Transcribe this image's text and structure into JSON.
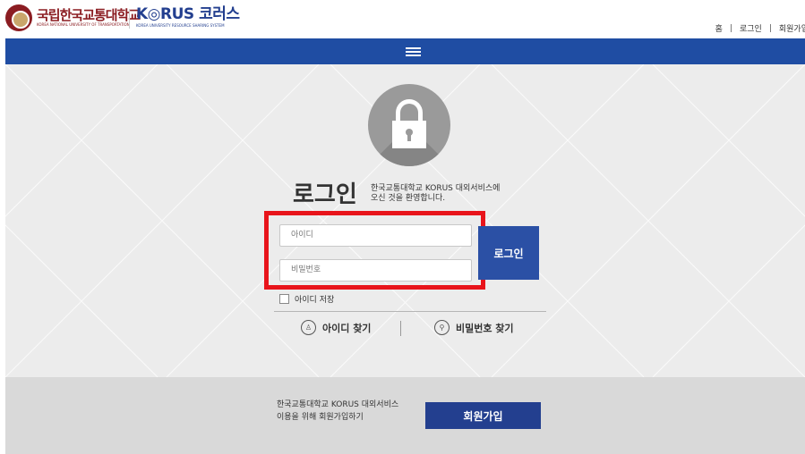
{
  "header": {
    "univ_name": "국립한국교통대학교",
    "univ_sub": "KOREA NATIONAL UNIVERSITY OF TRANSPORTATION",
    "korus_name": "K◎RUS 코러스",
    "korus_sub": "KOREA UNIVERSITY RESOURCE SHARING SYSTEM",
    "nav": {
      "home": "홈",
      "login": "로그인",
      "signup": "회원가입",
      "separator": "|"
    }
  },
  "login": {
    "title": "로그인",
    "welcome_line1": "한국교통대학교 KORUS 대외서비스에",
    "welcome_line2": "오신 것을 환영합니다.",
    "id_placeholder": "아이디",
    "pw_placeholder": "비밀번호",
    "button": "로그인",
    "save_id": "아이디 저장",
    "find_id": "아이디 찾기",
    "find_pw": "비밀번호 찾기"
  },
  "signup_banner": {
    "line1": "한국교통대학교 KORUS 대외서비스",
    "line2": "이용을 위해 회원가입하기",
    "button": "회원가입"
  },
  "colors": {
    "brand_blue": "#1f4da3",
    "button_blue": "#2b50a5",
    "dark_blue": "#233f8f",
    "highlight_red": "#e8141b",
    "univ_red": "#8b1d22"
  }
}
